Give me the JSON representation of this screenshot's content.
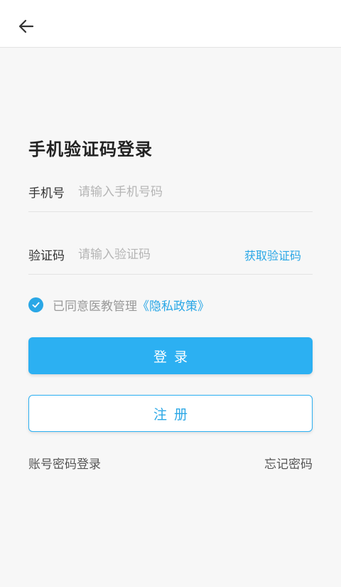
{
  "header": {
    "back_icon": "arrow-left-icon"
  },
  "title": "手机验证码登录",
  "phone_field": {
    "label": "手机号",
    "placeholder": "请输入手机号码",
    "value": ""
  },
  "code_field": {
    "label": "验证码",
    "placeholder": "请输入验证码",
    "value": "",
    "get_code_label": "获取验证码"
  },
  "agreement": {
    "checked": true,
    "text": "已同意医教管理",
    "link_text": "《隐私政策》"
  },
  "buttons": {
    "login_label": "登录",
    "register_label": "注册"
  },
  "links": {
    "password_login": "账号密码登录",
    "forgot_password": "忘记密码"
  },
  "colors": {
    "accent": "#2cb0f2",
    "link": "#2aa7e6",
    "background": "#f7f7f7"
  }
}
